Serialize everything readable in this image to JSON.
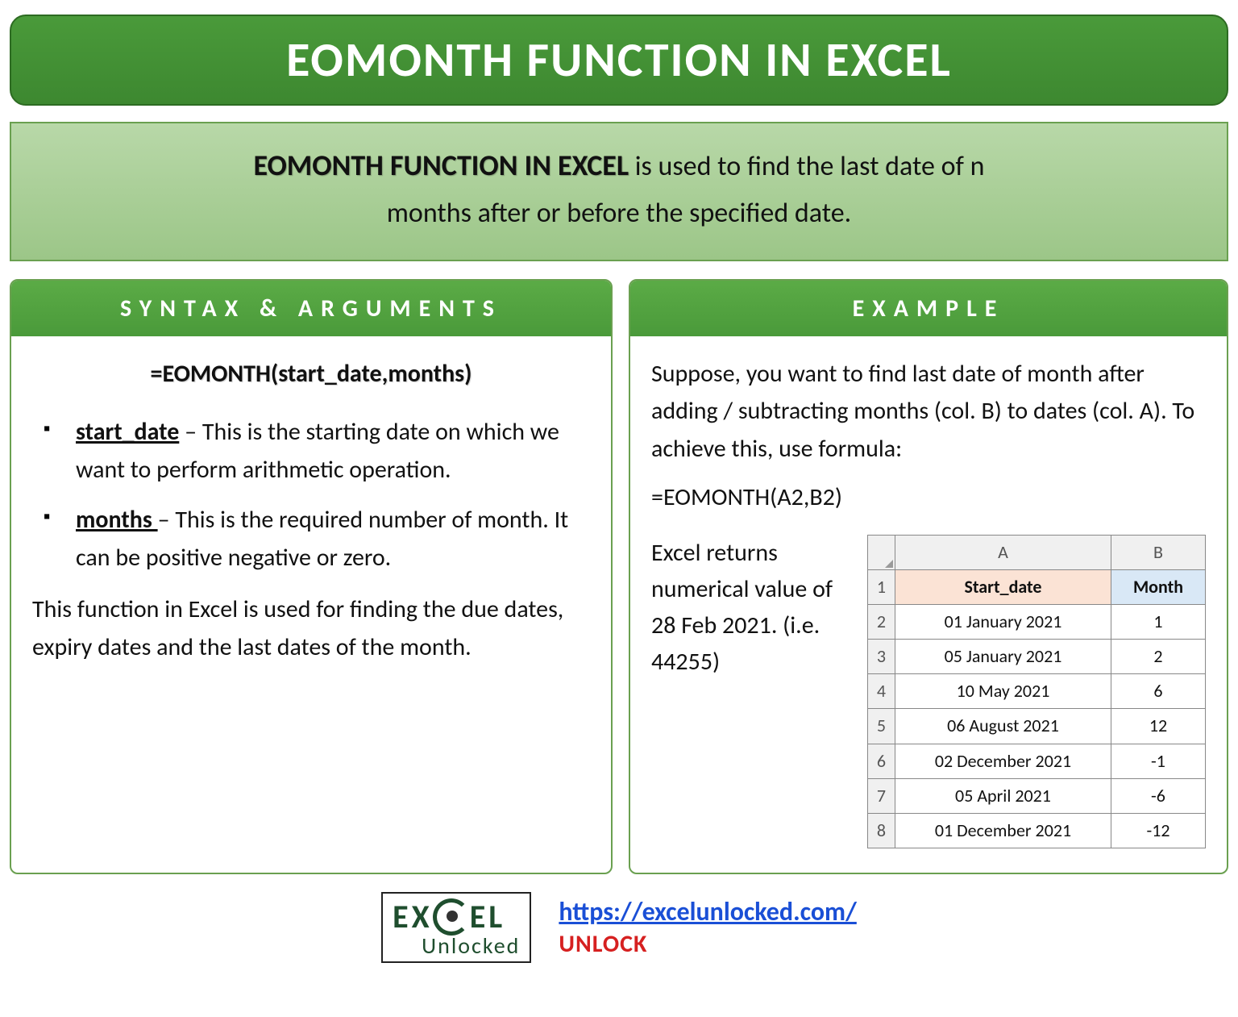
{
  "title": "EOMONTH FUNCTION IN EXCEL",
  "intro": {
    "lead": "EOMONTH FUNCTION IN EXCEL",
    "rest1": " is used to find the last date of n",
    "rest2": "months after or before the specified date."
  },
  "syntax": {
    "header": "SYNTAX & ARGUMENTS",
    "formula": "=EOMONTH(start_date,months)",
    "args": [
      {
        "name": "start_date",
        "desc": " – This is the starting date on which we want to perform arithmetic operation."
      },
      {
        "name": "months ",
        "desc": "– This is the required number of month. It can be positive negative or zero."
      }
    ],
    "note": "This function in Excel is used for finding the due dates, expiry dates and the last dates of the month."
  },
  "example": {
    "header": "EXAMPLE",
    "para": "Suppose, you want to find last date of month after adding / subtracting months (col. B) to dates (col. A). To achieve this, use formula:",
    "formula": "=EOMONTH(A2,B2)",
    "result_text": "Excel returns numerical value of 28 Feb 2021. (i.e. 44255)",
    "table": {
      "col_a": "A",
      "col_b": "B",
      "headers": {
        "a": "Start_date",
        "b": "Month"
      },
      "rows": [
        {
          "n": "2",
          "a": "01 January 2021",
          "b": "1"
        },
        {
          "n": "3",
          "a": "05 January 2021",
          "b": "2"
        },
        {
          "n": "4",
          "a": "10 May 2021",
          "b": "6"
        },
        {
          "n": "5",
          "a": "06 August 2021",
          "b": "12"
        },
        {
          "n": "6",
          "a": "02 December 2021",
          "b": "-1"
        },
        {
          "n": "7",
          "a": "05 April 2021",
          "b": "-6"
        },
        {
          "n": "8",
          "a": "01 December 2021",
          "b": "-12"
        }
      ]
    }
  },
  "footer": {
    "logo_top": "EX   EL",
    "logo_bottom": "Unlocked",
    "url": "https://excelunlocked.com/",
    "unlock": "UNLOCK"
  }
}
